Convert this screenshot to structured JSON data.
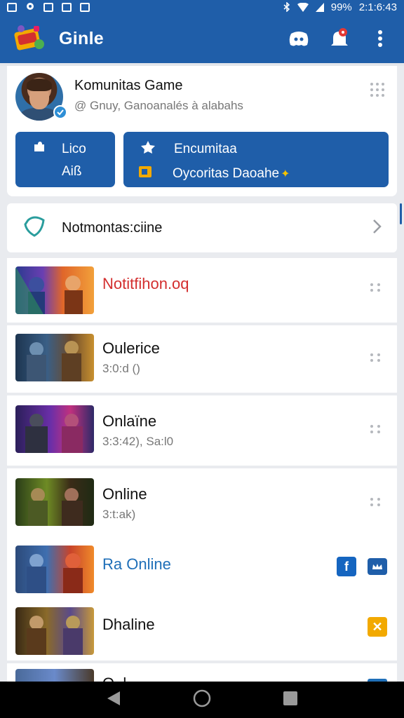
{
  "status_bar": {
    "battery": "99%",
    "time": "2:1:6:43",
    "icons": [
      "notification-icon",
      "location-icon",
      "image-icon",
      "image-icon",
      "image-icon",
      "bluetooth-icon",
      "wifi-icon",
      "signal-icon"
    ]
  },
  "app_bar": {
    "title": "Ginle",
    "icons": [
      "app-logo",
      "discord-icon",
      "notifications-bell-icon",
      "more-vert-icon"
    ],
    "notification_dot_color": "#e53935"
  },
  "profile": {
    "name": "Komunitas Game",
    "handle": "@ Gnuy, Ganoanalés à alabahs",
    "left_button": {
      "line1": "Lico",
      "line2": "Aiß"
    },
    "right_button": {
      "line1": "Encumitaa",
      "line2": "Oycoritas Daoahe"
    }
  },
  "notification_row": {
    "label": "Notmontas:ciine"
  },
  "list": [
    {
      "title": "Notitfihon.oq",
      "subtitle": "",
      "title_color": "#d32f2f",
      "thumb_text": "",
      "trailing": "kebab"
    },
    {
      "title": "Oulerice",
      "subtitle": "3:0:d ()",
      "title_color": "#111111",
      "thumb_text": "",
      "trailing": "kebab"
    },
    {
      "title": "Onlaïne",
      "subtitle": "3:3:42), Sa:l0",
      "title_color": "#111111",
      "thumb_text": "",
      "trailing": "kebab"
    },
    {
      "title": "Online",
      "subtitle": "3:t:ak)",
      "title_color": "#111111",
      "thumb_text": "",
      "trailing": "kebab"
    },
    {
      "title": "Ra Online",
      "subtitle": "",
      "title_color": "#1f6fb8",
      "thumb_text": "",
      "trailing": "social"
    },
    {
      "title": "Dhaline",
      "subtitle": "",
      "title_color": "#111111",
      "thumb_text": "",
      "trailing": "close-badge"
    },
    {
      "title": "O..l..",
      "subtitle": "",
      "title_color": "#111111",
      "thumb_text": "",
      "trailing": "partial"
    }
  ],
  "colors": {
    "primary": "#1f5ea9",
    "accent_red": "#d32f2f",
    "accent_blue_text": "#1f6fb8",
    "badge_facebook": "#1565c0",
    "badge_close": "#f2a900"
  },
  "nav_bar": {
    "icons": [
      "back-icon",
      "home-icon",
      "recents-icon"
    ]
  }
}
